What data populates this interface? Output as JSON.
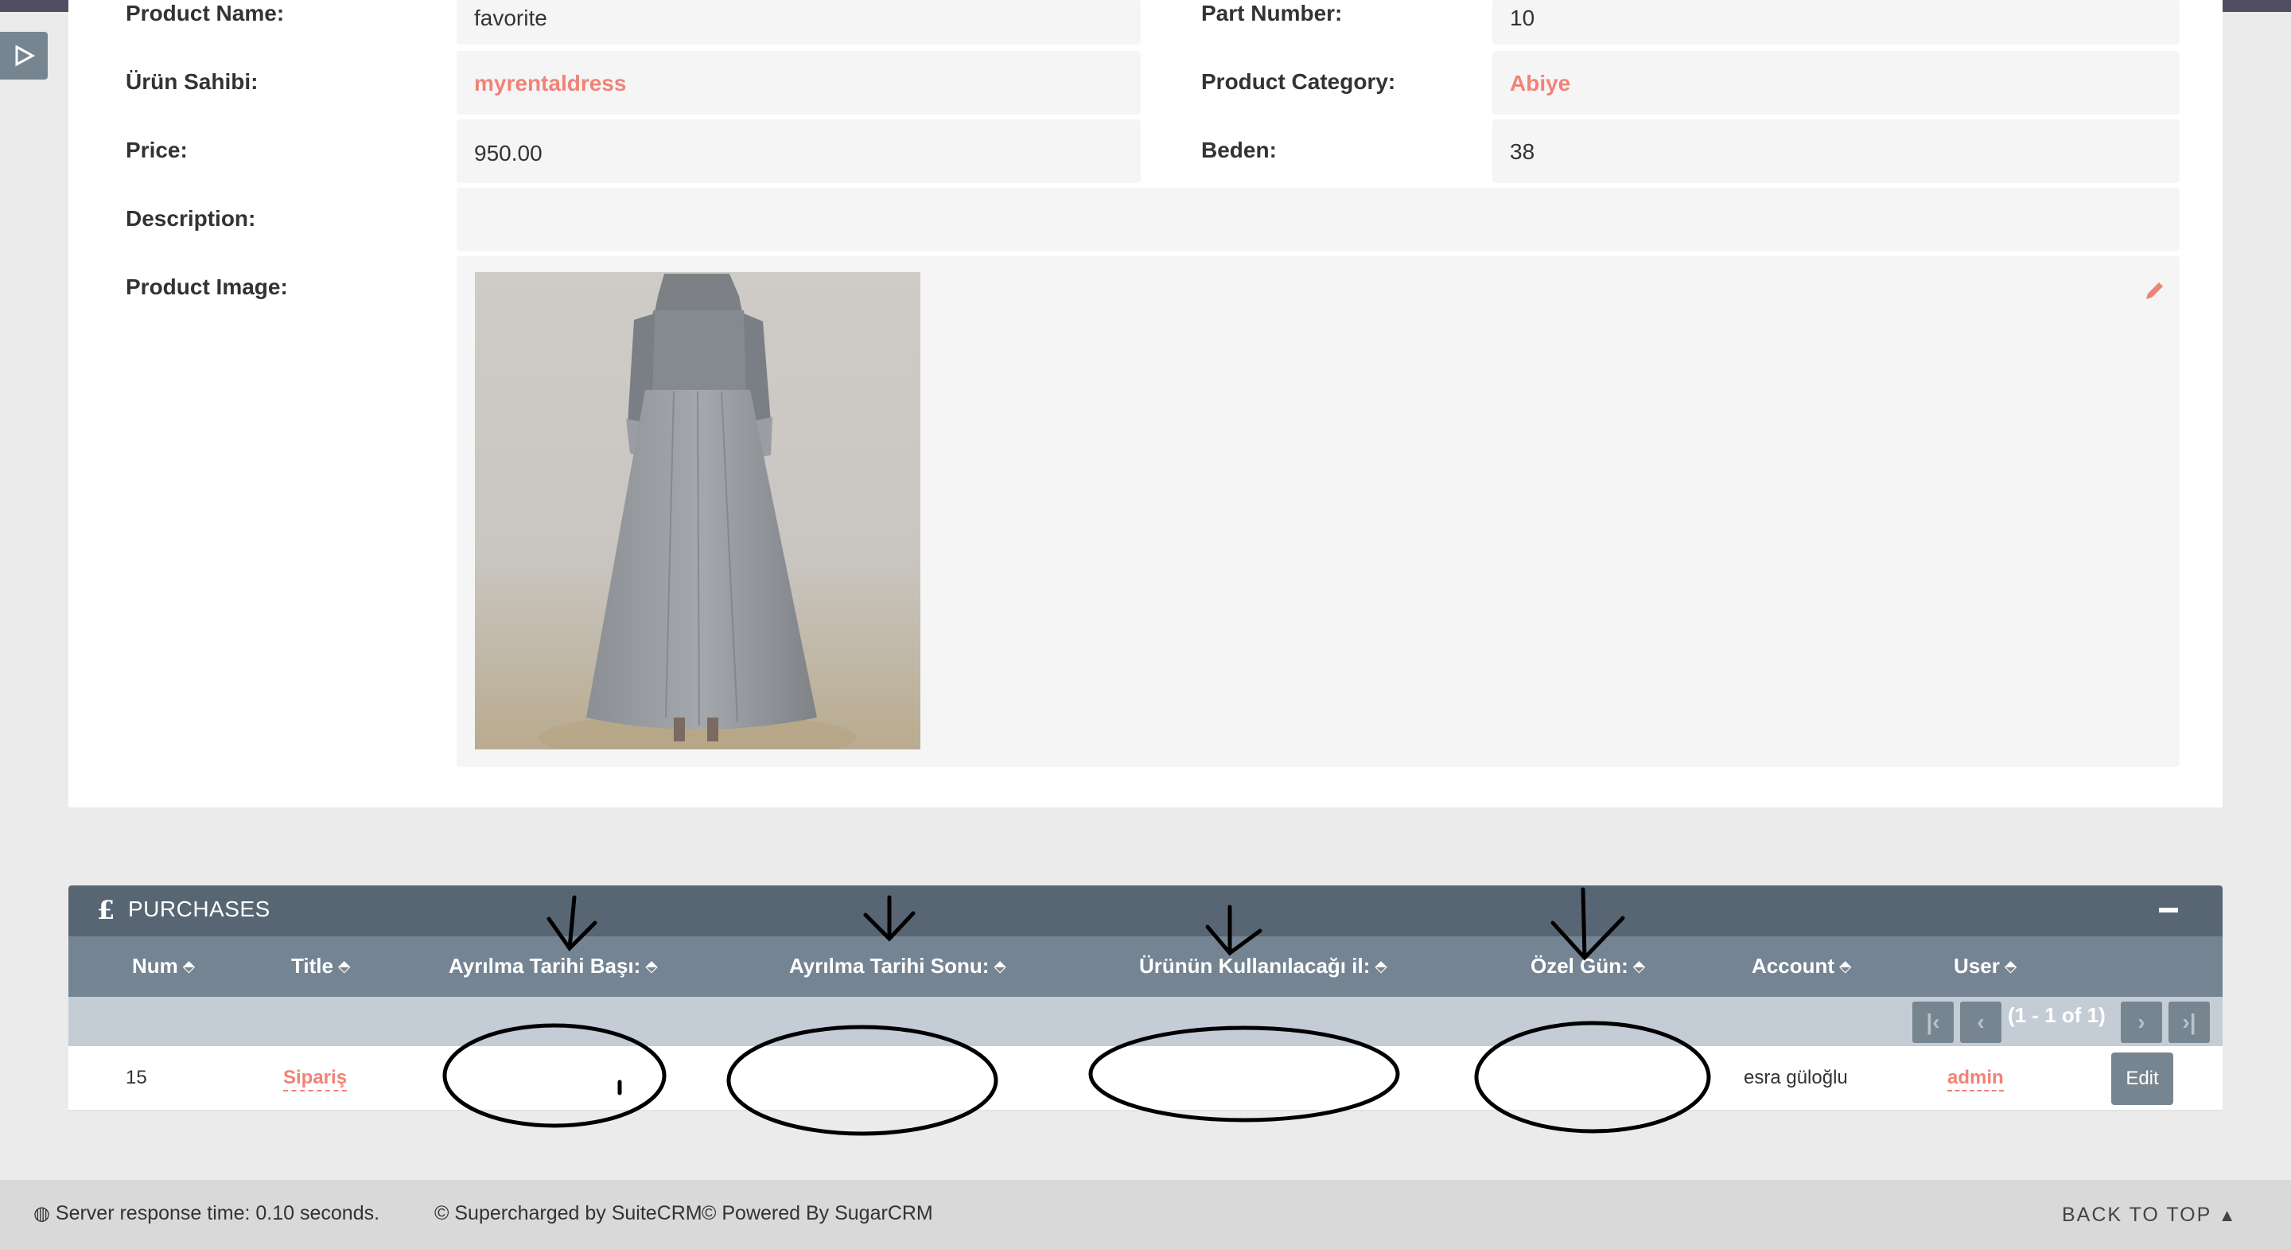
{
  "detail": {
    "product_name_label": "Product Name:",
    "product_name_value": "favorite",
    "part_number_label": "Part Number:",
    "part_number_value": "10",
    "owner_label": "Ürün Sahibi:",
    "owner_value": "myrentaldress",
    "category_label": "Product Category:",
    "category_value": "Abiye",
    "price_label": "Price:",
    "price_value": "950.00",
    "size_label": "Beden:",
    "size_value": "38",
    "description_label": "Description:",
    "description_value": "",
    "image_label": "Product Image:"
  },
  "purchases": {
    "title": "PURCHASES",
    "icon": "pound-icon",
    "columns": [
      "Num",
      "Title",
      "Ayrılma Tarihi Başı:",
      "Ayrılma Tarihi Sonu:",
      "Ürünün Kullanılacağı il:",
      "Özel Gün:",
      "Account",
      "User"
    ],
    "pagination": "(1 - 1 of 1)",
    "rows": [
      {
        "num": "15",
        "title": "Sipariş",
        "start": "",
        "end": "",
        "city": "",
        "special_day": "",
        "account": "esra güloğlu",
        "user": "admin",
        "edit": "Edit"
      }
    ]
  },
  "footer": {
    "response_time": "Server response time: 0.10 seconds.",
    "supercharged": "© Supercharged by SuiteCRM",
    "powered": "© Powered By SugarCRM",
    "back_to_top": "BACK TO TOP"
  },
  "colors": {
    "accent": "#f08377",
    "header": "#586674",
    "topbar": "#534d64"
  }
}
